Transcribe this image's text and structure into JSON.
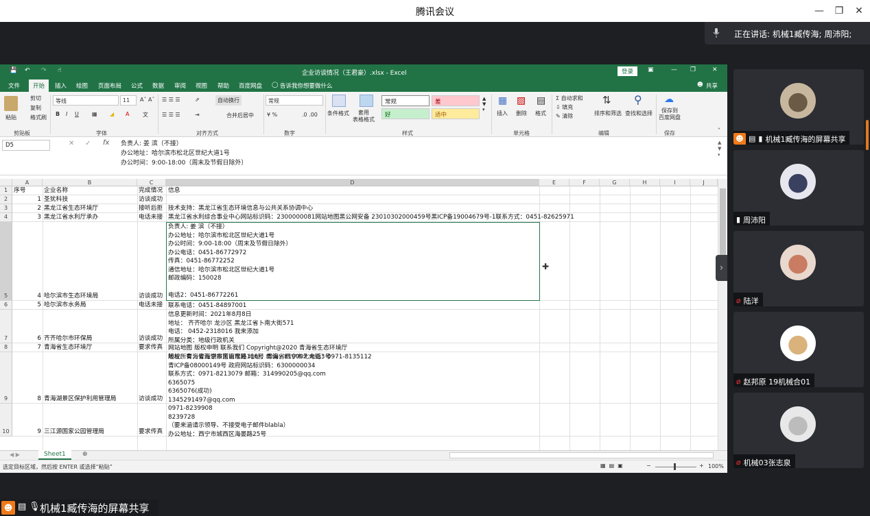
{
  "app": {
    "title": "腾讯会议"
  },
  "speaking": {
    "text": "正在讲话: 机械1臧传海; 周沛阳;"
  },
  "excel": {
    "title": "企业访谈情况（王君豪）.xlsx - Excel",
    "login": "登录",
    "share": "共享",
    "tabs": [
      "文件",
      "开始",
      "插入",
      "绘图",
      "页面布局",
      "公式",
      "数据",
      "审阅",
      "视图",
      "帮助",
      "百度网盘"
    ],
    "tellme": "告诉我你想要做什么",
    "ribbon": {
      "cut": "剪切",
      "copy": "复制",
      "format_painter": "格式刷",
      "paste": "粘贴",
      "clipboard": "剪贴板",
      "font_name": "等线",
      "font_size": "11",
      "font_group": "字体",
      "wrap": "自动换行",
      "merge": "合并后居中",
      "align_group": "对齐方式",
      "number_format": "常规",
      "number_group": "数字",
      "cond_format": "条件格式",
      "table_format": "套用\n表格格式",
      "styles": [
        "常规",
        "差",
        "好",
        "适中"
      ],
      "styles_group": "样式",
      "insert": "插入",
      "delete": "删除",
      "format": "格式",
      "cells_group": "单元格",
      "autosum": "自动求和",
      "fill": "填充",
      "clear": "清除",
      "sort": "排序和筛选",
      "find": "查找和选择",
      "edit_group": "编辑",
      "save_baidu": "保存到\n百度网盘",
      "save_group": "保存"
    },
    "namebox": "D5",
    "formula": "负责人: 姜 滨（不接）\n办公地址：哈尔滨市松北区世纪大道1号\n办公时间：9:00-18:00（周末及节假日除外）",
    "columns": [
      "A",
      "B",
      "C",
      "D",
      "E",
      "F",
      "G",
      "H",
      "I",
      "J"
    ],
    "rows": [
      {
        "n": "1",
        "a": "序号",
        "b": "企业名称",
        "c": "完成情况",
        "d": [
          "信息"
        ]
      },
      {
        "n": "2",
        "a": "1",
        "b": "圣犹科技",
        "c": "访谈成功",
        "d": [
          ""
        ]
      },
      {
        "n": "3",
        "a": "2",
        "b": "黑龙江省生态环境厅",
        "c": "接听后拒",
        "d": [
          "技术支持：黑龙江省生态环境信息与公共关系协调中心"
        ]
      },
      {
        "n": "4",
        "a": "3",
        "b": "黑龙江省水利厅承办",
        "c": "电话未接",
        "d": [
          "黑龙江省水利综合事业中心网站标识码：2300000081网站地图黑公网安备 23010302000459号黑ICP备19004679号-1联系方式：0451-82625971"
        ]
      },
      {
        "n": "5",
        "a": "4",
        "b": "哈尔滨市生态环境局",
        "c": "访谈成功",
        "d": [
          "负责人: 姜 滨（不接）",
          "办公地址：哈尔滨市松北区世纪大道1号",
          "办公时间：9:00-18:00（周末及节假日除外）",
          "办公电话：0451-86772972",
          "传真：0451-86772252",
          "通信地址：哈尔滨市松北区世纪大道1号",
          "邮政编码：150028",
          "",
          "电话2：0451-86772261"
        ]
      },
      {
        "n": "6",
        "a": "5",
        "b": "哈尔滨市水务局",
        "c": "电话未接",
        "d": [
          "联系电话：0451-84897001"
        ]
      },
      {
        "n": "7",
        "a": "6",
        "b": "齐齐哈尔市环保局",
        "c": "访谈成功",
        "d": [
          "信息更新时间：2021年8月8日",
          "地址：  齐齐哈尔 龙沙区 黑龙江省卜南大街571",
          "电话：  0452-2318016 我来添加",
          "所属分类：地级行政机关"
        ]
      },
      {
        "n": "8",
        "a": "7",
        "b": "青海省生态环境厅",
        "c": "要求传真",
        "d": [
          "网站地图  版权申明  联系我们 Copyright@2020  青海省生态环境厅",
          "地址：青海省西宁市南山东路116号     邮编：810007     电话：0971-8135112"
        ]
      },
      {
        "n": "9",
        "a": "8",
        "b": "青海湖景区保护利用管理局",
        "c": "访谈成功",
        "d": [
          "版权所有：青海湖景区管理局       地址：青海省西宁市北大街3号",
          "      青ICP备08000149号   政府网站标识码：6300000034",
          "联系方式：0971-8213079     邮箱：314990205@qq.com",
          "6365075",
          "6365076(成功)",
          "1345291497@qq.com"
        ]
      },
      {
        "n": "10",
        "a": "9",
        "b": "三江源国家公园管理局",
        "c": "要求传真",
        "d": [
          "0971-8239908",
          "8239728",
          "（要来涵请示领导、不接受电子邮件blabla）",
          "办公地址：西宁市城西区海晏路25号"
        ]
      }
    ],
    "sheet": "Sheet1",
    "status_text": "选定目标区域，然后按 ENTER 或选择“粘贴”",
    "zoom": "100%"
  },
  "participants": [
    {
      "name": "机械1臧传海的屏幕共享",
      "sharing": true,
      "muted": false
    },
    {
      "name": "周沛阳",
      "sharing": false,
      "muted": false
    },
    {
      "name": "陆洋",
      "sharing": false,
      "muted": true
    },
    {
      "name": "赵邦原 19机械合01",
      "sharing": false,
      "muted": true
    },
    {
      "name": "机械03张志泉",
      "sharing": false,
      "muted": true
    }
  ],
  "bottom_share": {
    "label": "机械1臧传海的屏幕共享"
  }
}
